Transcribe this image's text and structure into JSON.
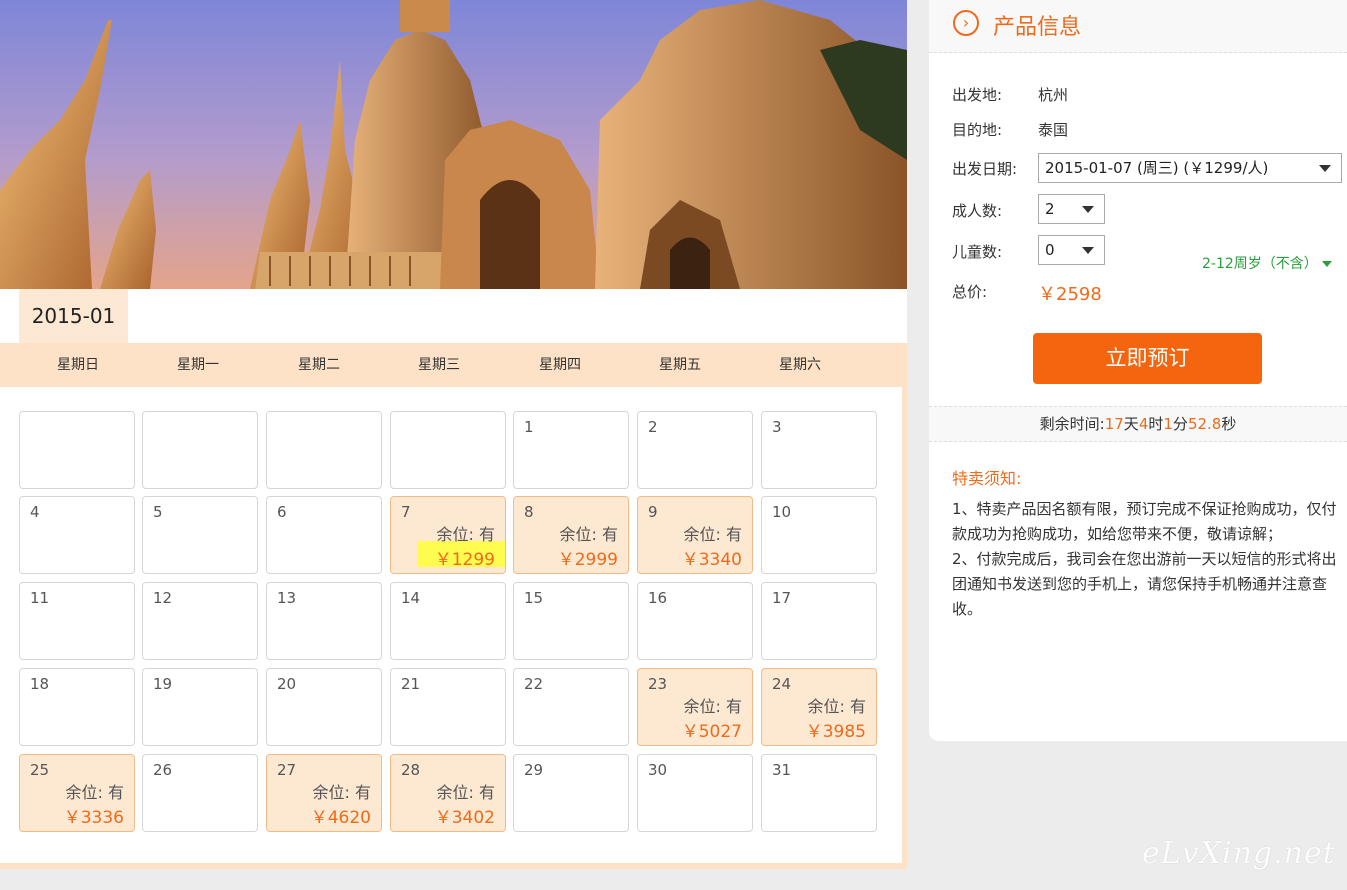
{
  "banner": {
    "alt": "temple-photo"
  },
  "calendar": {
    "month": "2015-01",
    "weekdays": [
      "星期日",
      "星期一",
      "星期二",
      "星期三",
      "星期四",
      "星期五",
      "星期六"
    ],
    "weeks": [
      [
        {
          "day": ""
        },
        {
          "day": ""
        },
        {
          "day": ""
        },
        {
          "day": ""
        },
        {
          "day": "1"
        },
        {
          "day": "2"
        },
        {
          "day": "3"
        }
      ],
      [
        {
          "day": "4"
        },
        {
          "day": "5"
        },
        {
          "day": "6"
        },
        {
          "day": "7",
          "seat": "余位: 有",
          "price": "￥1299",
          "highlight": true
        },
        {
          "day": "8",
          "seat": "余位: 有",
          "price": "￥2999"
        },
        {
          "day": "9",
          "seat": "余位: 有",
          "price": "￥3340"
        },
        {
          "day": "10"
        }
      ],
      [
        {
          "day": "11"
        },
        {
          "day": "12"
        },
        {
          "day": "13"
        },
        {
          "day": "14"
        },
        {
          "day": "15"
        },
        {
          "day": "16"
        },
        {
          "day": "17"
        }
      ],
      [
        {
          "day": "18"
        },
        {
          "day": "19"
        },
        {
          "day": "20"
        },
        {
          "day": "21"
        },
        {
          "day": "22"
        },
        {
          "day": "23",
          "seat": "余位: 有",
          "price": "￥5027"
        },
        {
          "day": "24",
          "seat": "余位: 有",
          "price": "￥3985"
        }
      ],
      [
        {
          "day": "25",
          "seat": "余位: 有",
          "price": "￥3336"
        },
        {
          "day": "26"
        },
        {
          "day": "27",
          "seat": "余位: 有",
          "price": "￥4620"
        },
        {
          "day": "28",
          "seat": "余位: 有",
          "price": "￥3402"
        },
        {
          "day": "29"
        },
        {
          "day": "30"
        },
        {
          "day": "31"
        }
      ]
    ]
  },
  "panel": {
    "title": "产品信息",
    "depart_label": "出发地:",
    "depart_value": "杭州",
    "dest_label": "目的地:",
    "dest_value": "泰国",
    "date_label": "出发日期:",
    "date_value": "2015-01-07 (周三) (￥1299/人)",
    "adults_label": "成人数:",
    "adults_value": "2",
    "children_label": "儿童数:",
    "children_value": "0",
    "children_hint": "2-12周岁（不含）",
    "total_label": "总价:",
    "total_value": "￥2598",
    "book_label": "立即预订"
  },
  "timer": {
    "prefix": "剩余时间:",
    "days": "17",
    "days_unit": "天",
    "hours": "4",
    "hours_unit": "时",
    "minutes": "1",
    "minutes_unit": "分",
    "seconds": "52.8",
    "seconds_unit": "秒"
  },
  "notice": {
    "title": "特卖须知:",
    "line1": "1、特卖产品因名额有限，预订完成不保证抢购成功，仅付款成功为抢购成功，如给您带来不便，敬请谅解；",
    "line2": "2、付款完成后，我司会在您出游前一天以短信的形式将出团通知书发送到您的手机上，请您保持手机畅通并注意查收。"
  },
  "watermark": "eLvXing.net",
  "colors": {
    "accent": "#f06a1b",
    "cell_available": "#fde8d2",
    "header_band": "#fde2c7",
    "hint_green": "#2a9d3c"
  }
}
